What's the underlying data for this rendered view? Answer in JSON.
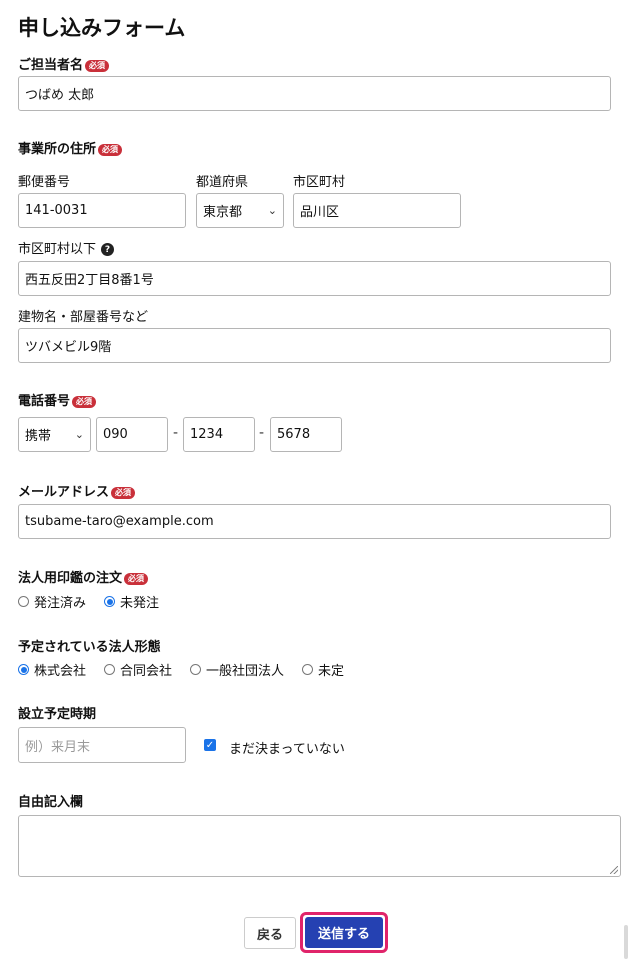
{
  "form": {
    "title": "申し込みフォーム",
    "required_badge": "必須",
    "contact_name": {
      "label": "ご担当者名",
      "value": "つばめ 太郎"
    },
    "address": {
      "label": "事業所の住所",
      "postal_label": "郵便番号",
      "postal_value": "141-0031",
      "prefecture_label": "都道府県",
      "prefecture_value": "東京都",
      "city_label": "市区町村",
      "city_value": "品川区",
      "street_label": "市区町村以下",
      "street_value": "西五反田2丁目8番1号",
      "building_label": "建物名・部屋番号など",
      "building_value": "ツバメビル9階"
    },
    "phone": {
      "label": "電話番号",
      "type_value": "携帯",
      "part1": "090",
      "part2": "1234",
      "part3": "5678",
      "separator": "-"
    },
    "email": {
      "label": "メールアドレス",
      "value": "tsubame-taro@example.com"
    },
    "seal_order": {
      "label": "法人用印鑑の注文",
      "options": [
        "発注済み",
        "未発注"
      ],
      "selected": "未発注"
    },
    "entity_type": {
      "label": "予定されている法人形態",
      "options": [
        "株式会社",
        "合同会社",
        "一般社団法人",
        "未定"
      ],
      "selected": "株式会社"
    },
    "establish_date": {
      "label": "設立予定時期",
      "placeholder": "例）来月末",
      "checkbox_label": "まだ決まっていない",
      "checked": true
    },
    "free_text": {
      "label": "自由記入欄",
      "value": ""
    },
    "buttons": {
      "back": "戻る",
      "submit": "送信する"
    }
  }
}
